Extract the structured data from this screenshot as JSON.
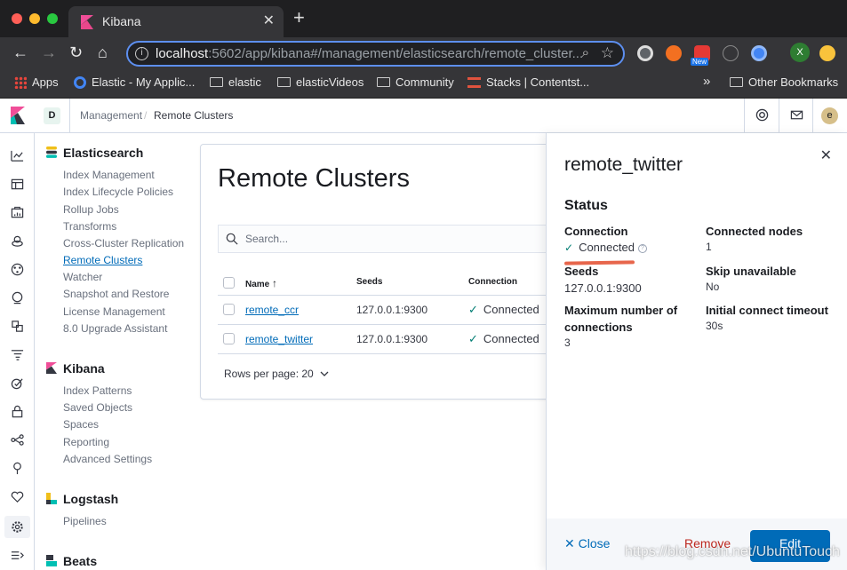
{
  "browser": {
    "tab_title": "Kibana",
    "tab_close": "✕",
    "new_tab": "+",
    "url_host": "localhost",
    "url_path": ":5602/app/kibana#/management/elasticsearch/remote_cluster...",
    "extension_badge": "New",
    "extension_x_label": "X",
    "bookmarks": [
      {
        "label": "Apps"
      },
      {
        "label": "Elastic - My Applic..."
      },
      {
        "label": "elastic"
      },
      {
        "label": "elasticVideos"
      },
      {
        "label": "Community"
      },
      {
        "label": "Stacks | Contentst..."
      }
    ],
    "more_bookmarks": "»",
    "other_bookmarks": "Other Bookmarks"
  },
  "header": {
    "space_initial": "D",
    "breadcrumbs": [
      "Management",
      "Remote Clusters"
    ],
    "breadcrumb_separator": "/",
    "avatar_initial": "e"
  },
  "sidenav": {
    "sections": [
      {
        "title": "Elasticsearch",
        "items": [
          "Index Management",
          "Index Lifecycle Policies",
          "Rollup Jobs",
          "Transforms",
          "Cross-Cluster Replication",
          "Remote Clusters",
          "Watcher",
          "Snapshot and Restore",
          "License Management",
          "8.0 Upgrade Assistant"
        ]
      },
      {
        "title": "Kibana",
        "items": [
          "Index Patterns",
          "Saved Objects",
          "Spaces",
          "Reporting",
          "Advanced Settings"
        ]
      },
      {
        "title": "Logstash",
        "items": [
          "Pipelines"
        ]
      },
      {
        "title": "Beats",
        "items": []
      }
    ],
    "active_item": "Remote Clusters"
  },
  "main": {
    "title": "Remote Clusters",
    "search_placeholder": "Search...",
    "columns": {
      "name": "Name",
      "sort_arrow": "↑",
      "seeds": "Seeds",
      "connection": "Connection"
    },
    "rows": [
      {
        "name": "remote_ccr",
        "seeds": "127.0.0.1:9300",
        "connection": "Connected"
      },
      {
        "name": "remote_twitter",
        "seeds": "127.0.0.1:9300",
        "connection": "Connected"
      }
    ],
    "check_glyph": "✓",
    "rows_per_page": "Rows per page: 20"
  },
  "flyout": {
    "title": "remote_twitter",
    "close_glyph": "✕",
    "status_heading": "Status",
    "fields": {
      "connection_label": "Connection",
      "connection_value": "Connected",
      "help_glyph": "?",
      "connected_nodes_label": "Connected nodes",
      "connected_nodes_value": "1",
      "seeds_label": "Seeds",
      "seeds_value": "127.0.0.1:9300",
      "skip_unavailable_label": "Skip unavailable",
      "skip_unavailable_value": "No",
      "max_connections_label": "Maximum number of connections",
      "max_connections_value": "3",
      "connect_timeout_label": "Initial connect timeout",
      "connect_timeout_value": "30s"
    },
    "footer": {
      "close": "✕  Close",
      "remove": "Remove",
      "edit": "Edit"
    }
  },
  "watermark": "https://blog.csdn.net/UbuntuTouch",
  "colors": {
    "link": "#006bb8",
    "success": "#017d73",
    "danger": "#bd271e",
    "annotation": "#e7664c"
  }
}
